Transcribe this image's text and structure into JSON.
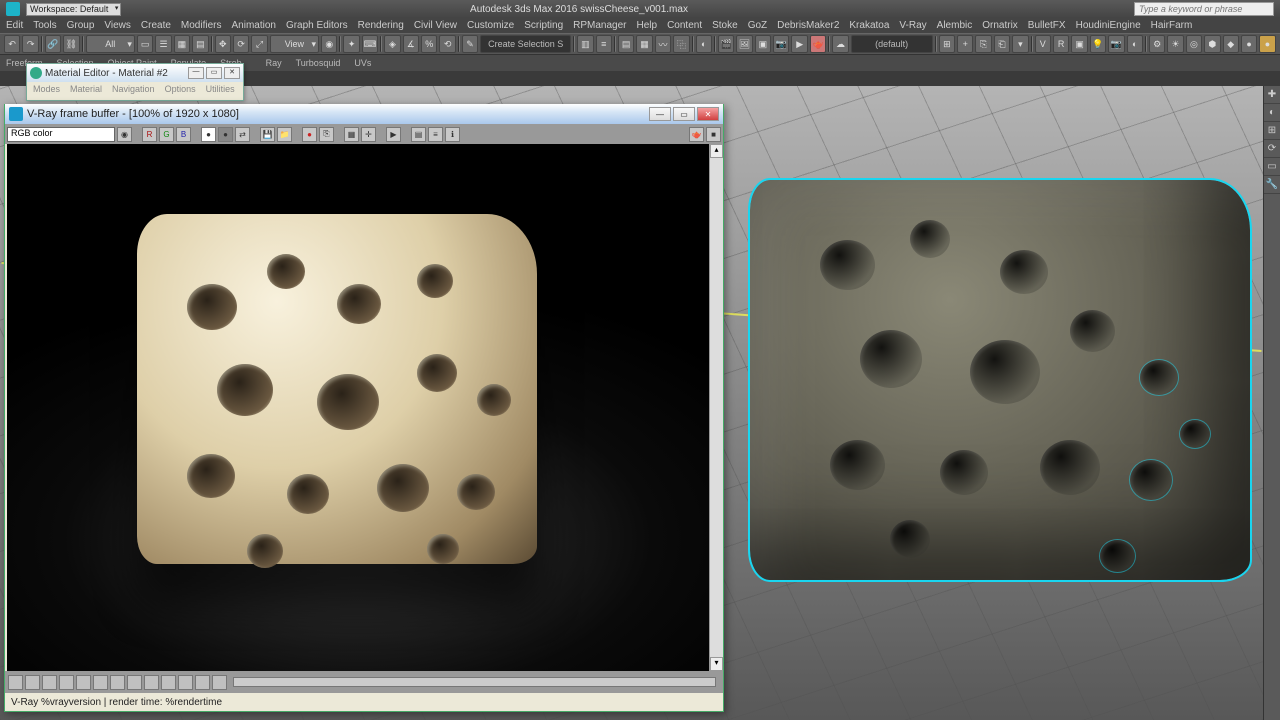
{
  "app": {
    "title": "Autodesk 3ds Max 2016   swissCheese_v001.max",
    "search_placeholder": "Type a keyword or phrase",
    "workspace_label": "Workspace: Default"
  },
  "menus": [
    "Edit",
    "Tools",
    "Group",
    "Views",
    "Create",
    "Modifiers",
    "Animation",
    "Graph Editors",
    "Rendering",
    "Civil View",
    "Customize",
    "Scripting",
    "RPManager",
    "Help",
    "Content",
    "Stoke",
    "GoZ",
    "DebrisMaker2",
    "Krakatoa",
    "V-Ray",
    "Alembic",
    "Ornatrix",
    "BulletFX",
    "HoudiniEngine",
    "HairFarm"
  ],
  "toolbar": {
    "selection_filter": "All",
    "view_label": "View",
    "named_sel": "Create Selection S",
    "render_preset": "(default)"
  },
  "ribbon_tabs": [
    "Freeform",
    "Selection",
    "Object Paint",
    "Populate",
    "Strob"
  ],
  "ribbon_extra": [
    "Ray",
    "Turbosquid",
    "UVs"
  ],
  "material_editor": {
    "title": "Material Editor - Material #2",
    "menus": [
      "Modes",
      "Material",
      "Navigation",
      "Options",
      "Utilities"
    ]
  },
  "vfb": {
    "title": "V-Ray frame buffer - [100% of 1920 x 1080]",
    "channel": "RGB color",
    "status": "V-Ray %vrayversion | render time: %rendertime",
    "btn_r": "R",
    "btn_g": "G",
    "btn_b": "B"
  },
  "win": {
    "min": "—",
    "max": "▭",
    "close": "✕"
  }
}
